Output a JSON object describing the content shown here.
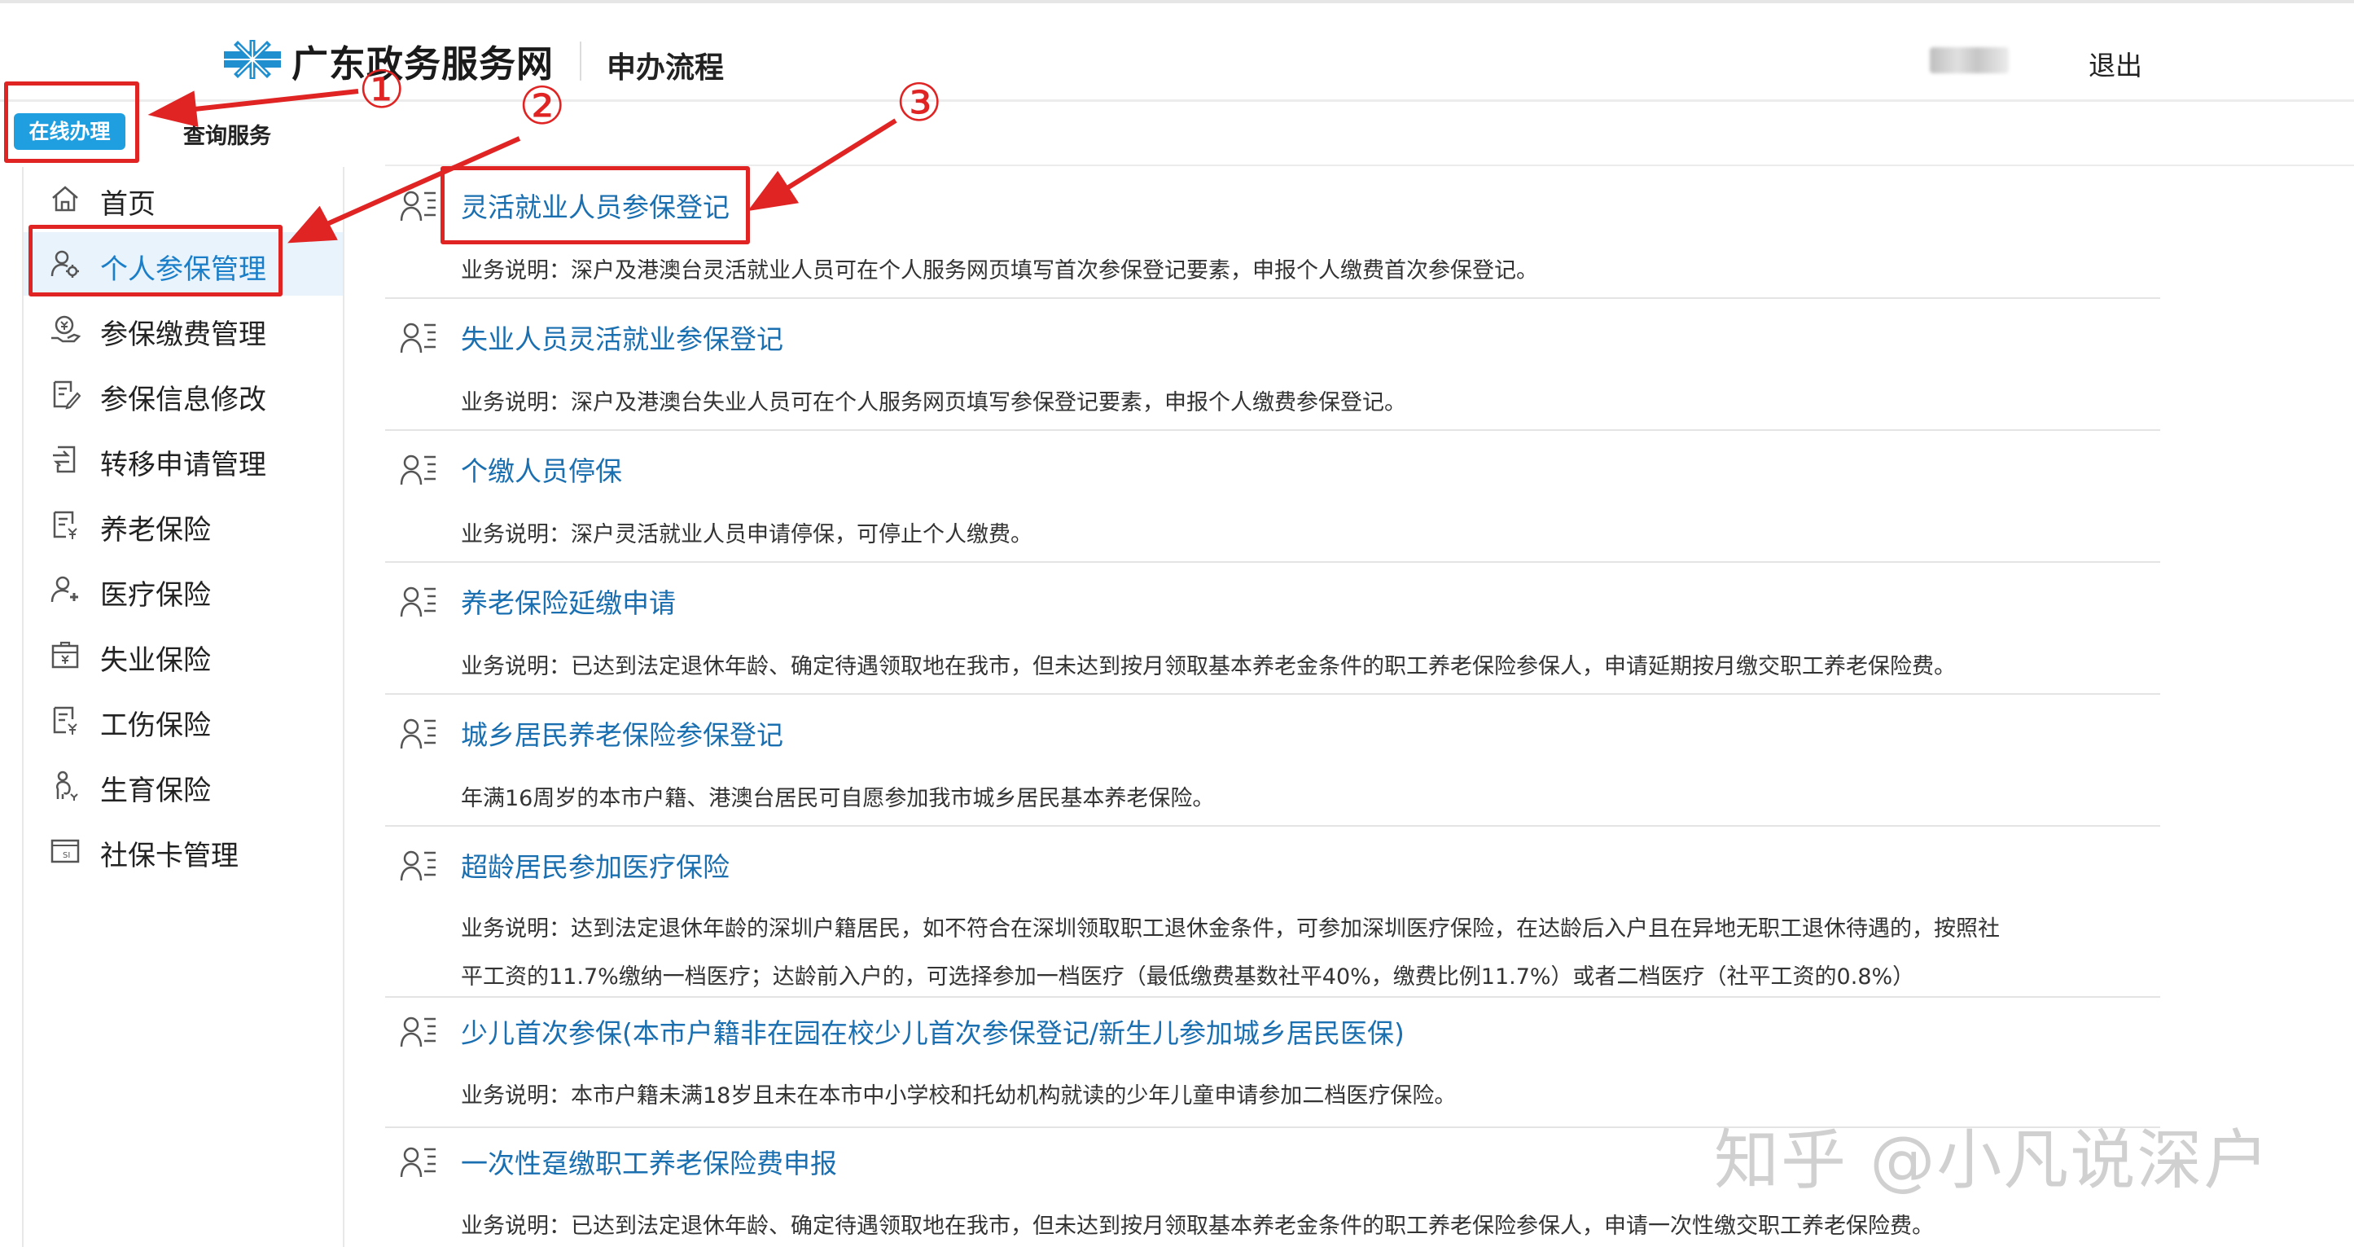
{
  "header": {
    "site_name": "广东政务服务网",
    "section_title": "申办流程",
    "logout_label": "退出",
    "logo_icon": "snowflake-logo-icon"
  },
  "tabs": [
    {
      "label": "在线办理",
      "active": true
    },
    {
      "label": "查询服务",
      "active": false
    }
  ],
  "sidebar": {
    "items": [
      {
        "label": "首页",
        "icon": "home-icon",
        "active": false
      },
      {
        "label": "个人参保管理",
        "icon": "person-gear-icon",
        "active": true
      },
      {
        "label": "参保缴费管理",
        "icon": "payment-icon",
        "active": false
      },
      {
        "label": "参保信息修改",
        "icon": "edit-doc-icon",
        "active": false
      },
      {
        "label": "转移申请管理",
        "icon": "transfer-icon",
        "active": false
      },
      {
        "label": "养老保险",
        "icon": "pension-doc-icon",
        "active": false
      },
      {
        "label": "医疗保险",
        "icon": "medical-person-icon",
        "active": false
      },
      {
        "label": "失业保险",
        "icon": "briefcase-icon",
        "active": false
      },
      {
        "label": "工伤保险",
        "icon": "injury-doc-icon",
        "active": false
      },
      {
        "label": "生育保险",
        "icon": "maternity-icon",
        "active": false
      },
      {
        "label": "社保卡管理",
        "icon": "card-icon",
        "active": false
      }
    ]
  },
  "services": [
    {
      "title": "灵活就业人员参保登记",
      "desc": [
        "业务说明：深户及港澳台灵活就业人员可在个人服务网页填写首次参保登记要素，申报个人缴费首次参保登记。"
      ]
    },
    {
      "title": "失业人员灵活就业参保登记",
      "desc": [
        "业务说明：深户及港澳台失业人员可在个人服务网页填写参保登记要素，申报个人缴费参保登记。"
      ]
    },
    {
      "title": "个缴人员停保",
      "desc": [
        "业务说明：深户灵活就业人员申请停保，可停止个人缴费。"
      ]
    },
    {
      "title": "养老保险延缴申请",
      "desc": [
        "业务说明：已达到法定退休年龄、确定待遇领取地在我市，但未达到按月领取基本养老金条件的职工养老保险参保人，申请延期按月缴交职工养老保险费。"
      ]
    },
    {
      "title": "城乡居民养老保险参保登记",
      "desc": [
        "年满16周岁的本市户籍、港澳台居民可自愿参加我市城乡居民基本养老保险。"
      ]
    },
    {
      "title": "超龄居民参加医疗保险",
      "desc": [
        "业务说明：达到法定退休年龄的深圳户籍居民，如不符合在深圳领取职工退休金条件，可参加深圳医疗保险，在达龄后入户且在异地无职工退休待遇的，按照社",
        "平工资的11.7%缴纳一档医疗；达龄前入户的，可选择参加一档医疗（最低缴费基数社平40%，缴费比例11.7%）或者二档医疗（社平工资的0.8%）"
      ]
    },
    {
      "title": "少儿首次参保(本市户籍非在园在校少儿首次参保登记/新生儿参加城乡居民医保)",
      "desc": [
        "业务说明：本市户籍未满18岁且未在本市中小学校和托幼机构就读的少年儿童申请参加二档医疗保险。"
      ]
    },
    {
      "title": "一次性趸缴职工养老保险费申报",
      "desc": [
        "业务说明：已达到法定退休年龄、确定待遇领取地在我市，但未达到按月领取基本养老金条件的职工养老保险参保人，申请一次性缴交职工养老保险费。"
      ]
    }
  ],
  "annotations": {
    "markers": [
      "①",
      "②",
      "③"
    ],
    "color": "#e02424"
  },
  "watermark": "知乎 @小凡说深户",
  "colors": {
    "accent": "#1f9fe0",
    "link": "#1a6fb0",
    "active_bg": "#e8f3fc"
  }
}
